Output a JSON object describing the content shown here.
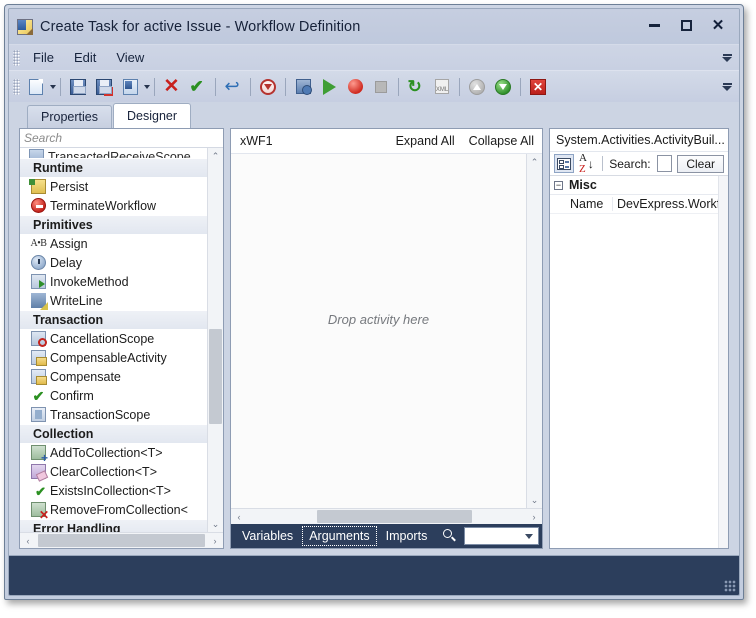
{
  "window": {
    "title": "Create Task for active Issue - Workflow Definition",
    "app_icon": "workflow-document-icon",
    "minimize_label": "",
    "maximize_label": "",
    "close_label": "✕"
  },
  "menubar": {
    "items": [
      {
        "label": "File"
      },
      {
        "label": "Edit"
      },
      {
        "label": "View"
      }
    ]
  },
  "toolbar": {
    "buttons": [
      {
        "icon": "new-document-icon",
        "has_caret": true
      },
      {
        "icon": "save-icon",
        "has_caret": false
      },
      {
        "icon": "save-close-icon",
        "has_caret": false
      },
      {
        "icon": "save-as-icon",
        "has_caret": true
      },
      {
        "icon": "delete-icon",
        "has_caret": false
      },
      {
        "icon": "accept-icon",
        "has_caret": false
      },
      {
        "icon": "undo-icon",
        "has_caret": false
      },
      {
        "icon": "stop-circle-icon",
        "has_caret": false
      },
      {
        "icon": "validate-icon",
        "has_caret": false
      },
      {
        "icon": "run-icon",
        "has_caret": false
      },
      {
        "icon": "record-icon",
        "has_caret": false
      },
      {
        "icon": "stop-icon",
        "has_caret": false
      },
      {
        "icon": "refresh-icon",
        "has_caret": false
      },
      {
        "icon": "xml-icon",
        "has_caret": false
      },
      {
        "icon": "move-up-icon",
        "has_caret": false
      },
      {
        "icon": "move-down-icon",
        "has_caret": false
      },
      {
        "icon": "close-box-icon",
        "has_caret": false
      }
    ]
  },
  "tabs": {
    "items": [
      {
        "label": "Properties",
        "active": false
      },
      {
        "label": "Designer",
        "active": true
      }
    ]
  },
  "toolbox": {
    "search_placeholder": "Search",
    "clipped_item": "TransactedReceiveScope",
    "groups": [
      {
        "label": "Runtime",
        "items": [
          {
            "label": "Persist",
            "icon": "persist-icon"
          },
          {
            "label": "TerminateWorkflow",
            "icon": "terminate-workflow-icon"
          }
        ]
      },
      {
        "label": "Primitives",
        "items": [
          {
            "label": "Assign",
            "icon": "assign-icon"
          },
          {
            "label": "Delay",
            "icon": "delay-icon"
          },
          {
            "label": "InvokeMethod",
            "icon": "invoke-method-icon"
          },
          {
            "label": "WriteLine",
            "icon": "write-line-icon"
          }
        ]
      },
      {
        "label": "Transaction",
        "items": [
          {
            "label": "CancellationScope",
            "icon": "cancellation-scope-icon"
          },
          {
            "label": "CompensableActivity",
            "icon": "compensable-activity-icon"
          },
          {
            "label": "Compensate",
            "icon": "compensate-icon"
          },
          {
            "label": "Confirm",
            "icon": "confirm-icon"
          },
          {
            "label": "TransactionScope",
            "icon": "transaction-scope-icon"
          }
        ]
      },
      {
        "label": "Collection",
        "items": [
          {
            "label": "AddToCollection<T>",
            "icon": "add-to-collection-icon"
          },
          {
            "label": "ClearCollection<T>",
            "icon": "clear-collection-icon"
          },
          {
            "label": "ExistsInCollection<T>",
            "icon": "exists-in-collection-icon"
          },
          {
            "label": "RemoveFromCollection<",
            "icon": "remove-from-collection-icon"
          }
        ]
      },
      {
        "label": "Error Handling",
        "items": []
      }
    ]
  },
  "designer": {
    "workflow_name": "xWF1",
    "expand_all_label": "Expand All",
    "collapse_all_label": "Collapse All",
    "drop_hint": "Drop activity here",
    "bottom_tabs": [
      {
        "label": "Variables",
        "focused": false
      },
      {
        "label": "Arguments",
        "focused": true
      },
      {
        "label": "Imports",
        "focused": false
      }
    ],
    "search_icon": "magnifier-icon",
    "zoom_combo_value": ""
  },
  "properties": {
    "title": "System.Activities.ActivityBuil...",
    "categorized_icon": "categorized-view-icon",
    "sort_icon": "alphabetical-sort-icon",
    "search_label": "Search:",
    "search_value": "",
    "clear_label": "Clear",
    "categories": [
      {
        "label": "Misc",
        "expanded": true,
        "rows": [
          {
            "name": "Name",
            "value": "DevExpress.Workfl"
          }
        ]
      }
    ]
  },
  "colors": {
    "window_chrome": "#c6cee0",
    "title_text": "#17223a",
    "status_bar": "#2c3e5c",
    "designer_tabs_bar": "#2c3e5c",
    "accent_red": "#c8201d",
    "accent_green": "#2b9021",
    "panel_border": "#8e9cb3"
  }
}
